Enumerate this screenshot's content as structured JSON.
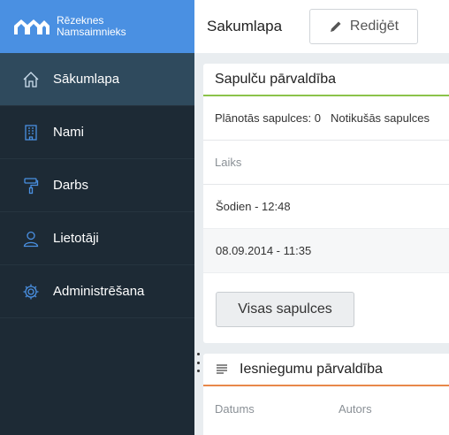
{
  "brand": {
    "line1": "Rēzeknes",
    "line2": "Namsaimnieks"
  },
  "sidebar": {
    "items": [
      {
        "label": "Sākumlapa",
        "icon": "home-icon",
        "active": true
      },
      {
        "label": "Nami",
        "icon": "building-icon",
        "active": false
      },
      {
        "label": "Darbs",
        "icon": "paint-roller-icon",
        "active": false
      },
      {
        "label": "Lietotāji",
        "icon": "user-icon",
        "active": false
      },
      {
        "label": "Administrēšana",
        "icon": "gear-icon",
        "active": false
      }
    ]
  },
  "topbar": {
    "title": "Sakumlapa",
    "edit_label": "Rediģēt"
  },
  "meetings": {
    "title": "Sapulču pārvaldība",
    "planned": "Plānotās sapulces: 0",
    "held": "Notikušās sapulces",
    "column": "Laiks",
    "rows": [
      "Šodien - 12:48",
      "08.09.2014 - 11:35"
    ],
    "all_label": "Visas sapulces"
  },
  "submissions": {
    "title": "Iesniegumu pārvaldība",
    "columns": [
      "Datums",
      "Autors"
    ]
  },
  "colors": {
    "brand": "#4a90e2",
    "sidebar": "#1d2a35",
    "active": "#2f4a5d",
    "meetings_accent": "#8bc34a",
    "submissions_accent": "#e8884a"
  }
}
